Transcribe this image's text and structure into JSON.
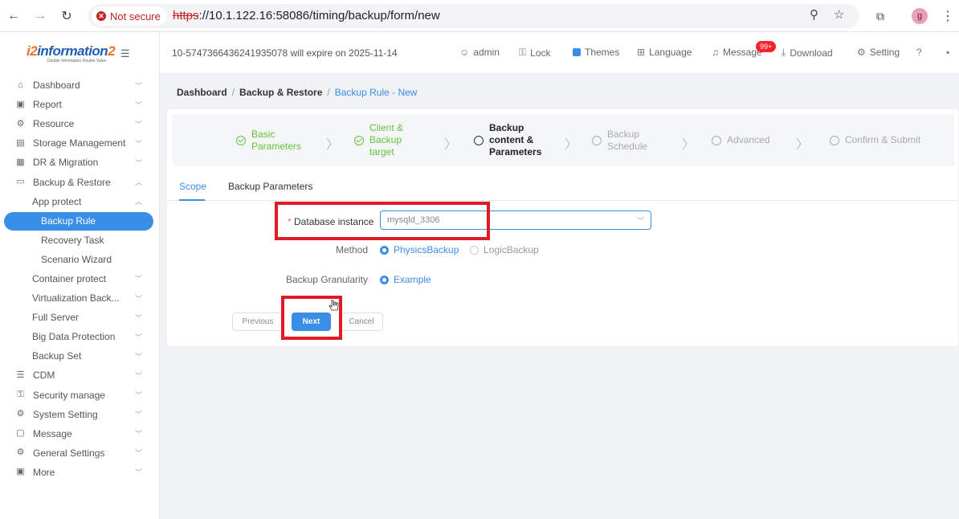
{
  "browser": {
    "insecure_label": "Not secure",
    "url_scheme": "https",
    "url_rest": "://10.1.122.16:58086/timing/backup/form/new",
    "profile_initial": "g"
  },
  "brand": {
    "logo_prefix": "i2",
    "logo_word": "information",
    "logo_suffix": "2",
    "tagline": "Double Information Double Value"
  },
  "topbar": {
    "expire_text": "10-5747366436241935078 will expire on 2025-11-14",
    "user": "admin",
    "lock": "Lock",
    "themes": "Themes",
    "language": "Language",
    "message": "Message",
    "message_badge": "99+",
    "download": "Download",
    "setting": "Setting"
  },
  "sidebar": {
    "items": [
      {
        "label": "Dashboard",
        "icon": "home-icon"
      },
      {
        "label": "Report",
        "icon": "report-icon"
      },
      {
        "label": "Resource",
        "icon": "resource-icon"
      },
      {
        "label": "Storage Management",
        "icon": "storage-icon"
      },
      {
        "label": "DR & Migration",
        "icon": "dr-icon"
      },
      {
        "label": "Backup & Restore",
        "icon": "monitor-icon"
      },
      {
        "label": "App protect"
      },
      {
        "label": "Backup Rule"
      },
      {
        "label": "Recovery Task"
      },
      {
        "label": "Scenario Wizard"
      },
      {
        "label": "Container protect"
      },
      {
        "label": "Virtualization Back..."
      },
      {
        "label": "Full Server"
      },
      {
        "label": "Big Data Protection"
      },
      {
        "label": "Backup Set"
      },
      {
        "label": "CDM",
        "icon": "cdm-icon"
      },
      {
        "label": "Security manage",
        "icon": "lock-icon"
      },
      {
        "label": "System Setting",
        "icon": "gear-icon"
      },
      {
        "label": "Message",
        "icon": "message-icon"
      },
      {
        "label": "General Settings",
        "icon": "gear-icon"
      },
      {
        "label": "More",
        "icon": "more-icon"
      }
    ]
  },
  "breadcrumb": {
    "level1": "Dashboard",
    "level2": "Backup & Restore",
    "current": "Backup Rule - New"
  },
  "steps": {
    "s1a": "Basic",
    "s1b": "Parameters",
    "s2a": "Client &",
    "s2b": "Backup",
    "s2c": "target",
    "s3a": "Backup",
    "s3b": "content &",
    "s3c": "Parameters",
    "s4a": "Backup",
    "s4b": "Schedule",
    "s5": "Advanced",
    "s6": "Confirm & Submit"
  },
  "tabs": {
    "scope": "Scope",
    "params": "Backup Parameters"
  },
  "form": {
    "db_label": "Database instance",
    "db_required_mark": "*",
    "db_value": "mysqld_3306",
    "method_label": "Method",
    "method_option1": "PhysicsBackup",
    "method_option2": "LogicBackup",
    "granularity_label": "Backup Granularity",
    "granularity_option": "Example"
  },
  "buttons": {
    "previous": "Previous",
    "next": "Next",
    "cancel": "Cancel"
  },
  "colors": {
    "accent": "#3a8ee6",
    "done_green": "#67c23a",
    "highlight_red": "#e01b24"
  }
}
